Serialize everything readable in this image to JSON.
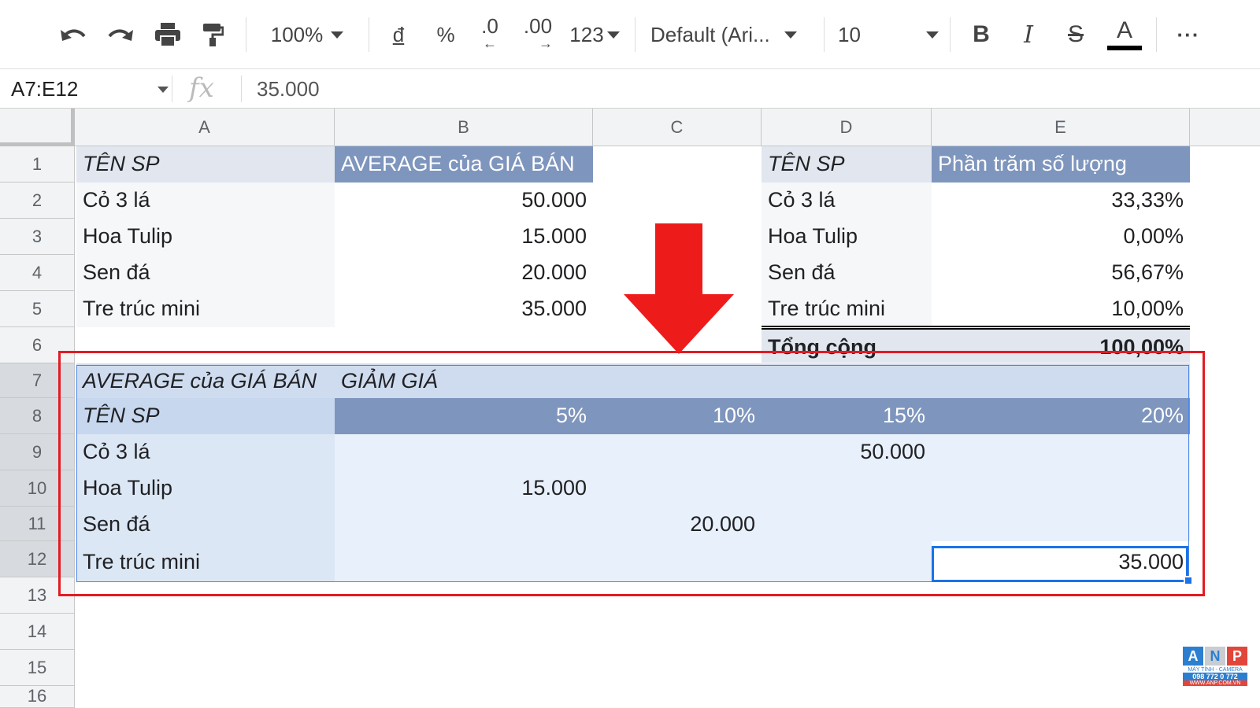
{
  "toolbar": {
    "zoom": "100%",
    "currency": "đ",
    "percent": "%",
    "decrease_decimal": ".0",
    "increase_decimal": ".00",
    "more_formats": "123",
    "font": "Default (Ari...",
    "font_size": "10",
    "bold": "B",
    "italic": "I",
    "strikethrough": "S",
    "text_color": "A",
    "more": "···"
  },
  "formula_bar": {
    "name_box": "A7:E12",
    "fx": "fx",
    "value": "35.000"
  },
  "columns": [
    "A",
    "B",
    "C",
    "D",
    "E"
  ],
  "rows": [
    "1",
    "2",
    "3",
    "4",
    "5",
    "6",
    "7",
    "8",
    "9",
    "10",
    "11",
    "12",
    "13",
    "14",
    "15",
    "16"
  ],
  "pivot1": {
    "header": [
      "TÊN SP",
      "AVERAGE của GIÁ BÁN"
    ],
    "rows": [
      [
        "Cỏ 3 lá",
        "50.000"
      ],
      [
        "Hoa Tulip",
        "15.000"
      ],
      [
        "Sen đá",
        "20.000"
      ],
      [
        "Tre trúc mini",
        "35.000"
      ]
    ]
  },
  "pivot2": {
    "header": [
      "TÊN SP",
      "Phần trăm số lượng"
    ],
    "rows": [
      [
        "Cỏ 3 lá",
        "33,33%"
      ],
      [
        "Hoa Tulip",
        "0,00%"
      ],
      [
        "Sen đá",
        "56,67%"
      ],
      [
        "Tre trúc mini",
        "10,00%"
      ]
    ],
    "total": [
      "Tổng cộng",
      "100,00%"
    ]
  },
  "pivot3": {
    "value_label": "AVERAGE của GIÁ BÁN",
    "column_field": "GIẢM GIÁ",
    "row_field": "TÊN SP",
    "discounts": [
      "5%",
      "10%",
      "15%",
      "20%"
    ],
    "rows": [
      {
        "name": "Cỏ 3 lá",
        "values": [
          "",
          "",
          "50.000",
          ""
        ]
      },
      {
        "name": "Hoa Tulip",
        "values": [
          "15.000",
          "",
          "",
          ""
        ]
      },
      {
        "name": "Sen đá",
        "values": [
          "",
          "20.000",
          "",
          ""
        ]
      },
      {
        "name": "Tre trúc mini",
        "values": [
          "",
          "",
          "",
          "35.000"
        ]
      }
    ]
  },
  "logo": {
    "letters": [
      "A",
      "N",
      "P"
    ],
    "line1": "MÁY TÍNH - CAMERA",
    "line2": "098 772 0 772",
    "line3": "WWW.ANP.COM.VN"
  },
  "colors": {
    "accent_red": "#e31b23",
    "selection_blue": "#1a73e8",
    "pivot_header": "#7e95bd"
  }
}
